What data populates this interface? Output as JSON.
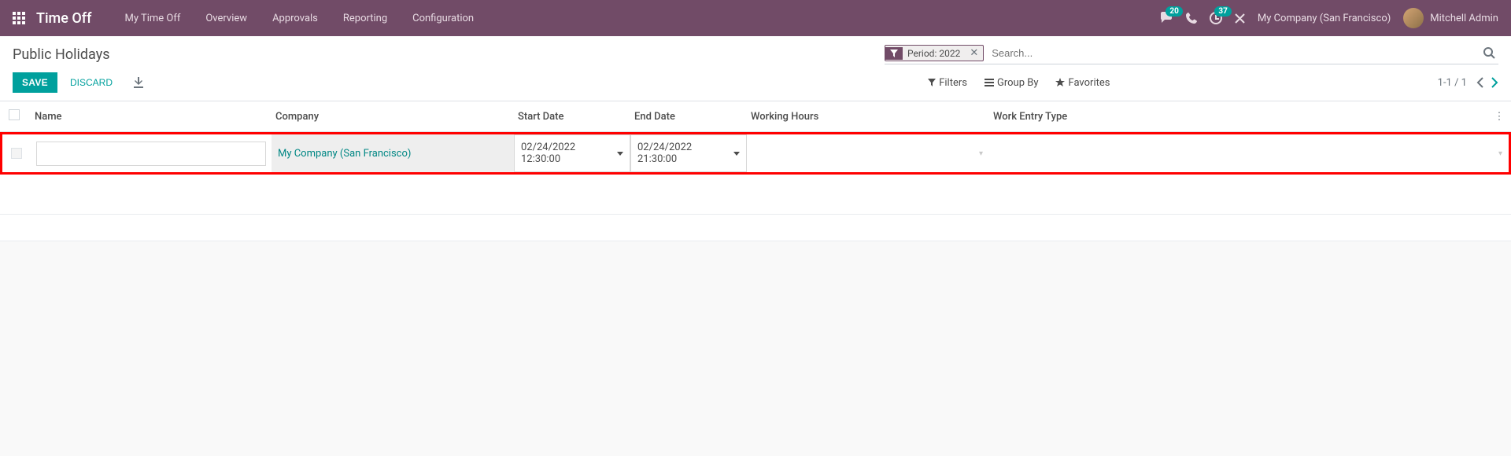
{
  "navbar": {
    "brand": "Time Off",
    "menu": [
      "My Time Off",
      "Overview",
      "Approvals",
      "Reporting",
      "Configuration"
    ],
    "messages_badge": "20",
    "activities_badge": "37",
    "company": "My Company (San Francisco)",
    "user": "Mitchell Admin"
  },
  "control_panel": {
    "title": "Public Holidays",
    "facet_label": "Period: 2022",
    "search_placeholder": "Search...",
    "save_label": "SAVE",
    "discard_label": "DISCARD",
    "filters_label": "Filters",
    "groupby_label": "Group By",
    "favorites_label": "Favorites",
    "pager": "1-1 / 1"
  },
  "table": {
    "headers": {
      "name": "Name",
      "company": "Company",
      "start": "Start Date",
      "end": "End Date",
      "wh": "Working Hours",
      "wet": "Work Entry Type"
    },
    "row": {
      "name": "",
      "company": "My Company (San Francisco)",
      "start": "02/24/2022 12:30:00",
      "end": "02/24/2022 21:30:00"
    }
  }
}
